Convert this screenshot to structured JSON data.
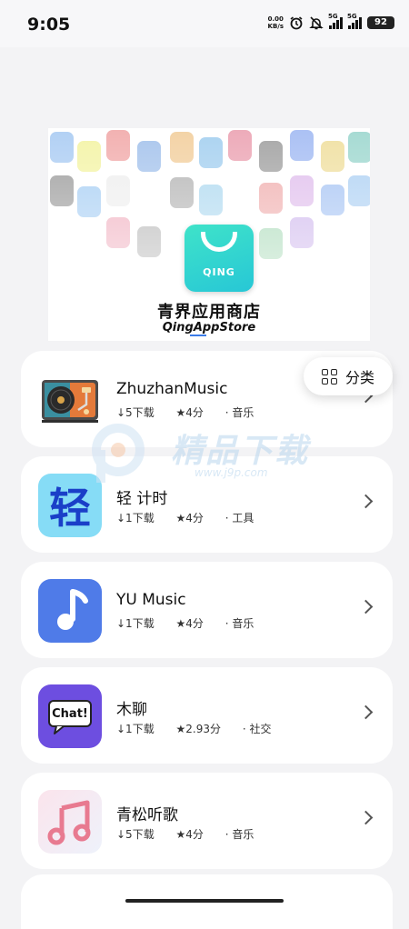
{
  "status_bar": {
    "time": "9:05",
    "net_speed_value": "0.00",
    "net_speed_unit": "KB/s",
    "signal1_label": "5G",
    "signal2_label": "5G",
    "battery": "92",
    "icons": [
      "alarm-icon",
      "mute-bell-icon",
      "signal-icon",
      "battery-icon"
    ]
  },
  "banner": {
    "logo_word": "QING",
    "title": "青界应用商店",
    "subtitle": "QingAppStore"
  },
  "category_button": {
    "label": "分类",
    "icon": "grid-icon"
  },
  "watermark": {
    "text": "精品下载",
    "url": "www.j9p.com"
  },
  "apps": [
    {
      "name": "ZhuzhanMusic",
      "downloads": "↓5下载",
      "rating": "★4分",
      "category": "· 音乐",
      "icon": "turntable-icon"
    },
    {
      "name": "轻 计时",
      "downloads": "↓1下载",
      "rating": "★4分",
      "category": "· 工具",
      "icon": "qing-character-icon",
      "icon_text": "轻"
    },
    {
      "name": "YU Music",
      "downloads": "↓1下载",
      "rating": "★4分",
      "category": "· 音乐",
      "icon": "music-note-icon"
    },
    {
      "name": "木聊",
      "downloads": "↓1下载",
      "rating": "★2.93分",
      "category": "· 社交",
      "icon": "chat-bubble-icon",
      "icon_text": "Chat!"
    },
    {
      "name": "青松听歌",
      "downloads": "↓5下载",
      "rating": "★4分",
      "category": "· 音乐",
      "icon": "pink-music-note-icon"
    }
  ],
  "colors": {
    "page_bg": "#f3f3f5",
    "card_bg": "#ffffff",
    "qing_logo": "#2fd4cf",
    "yu_music_icon": "#4f7be8",
    "chat_icon": "#6d4ee0",
    "qing_timer_icon": "#86dcf6"
  }
}
